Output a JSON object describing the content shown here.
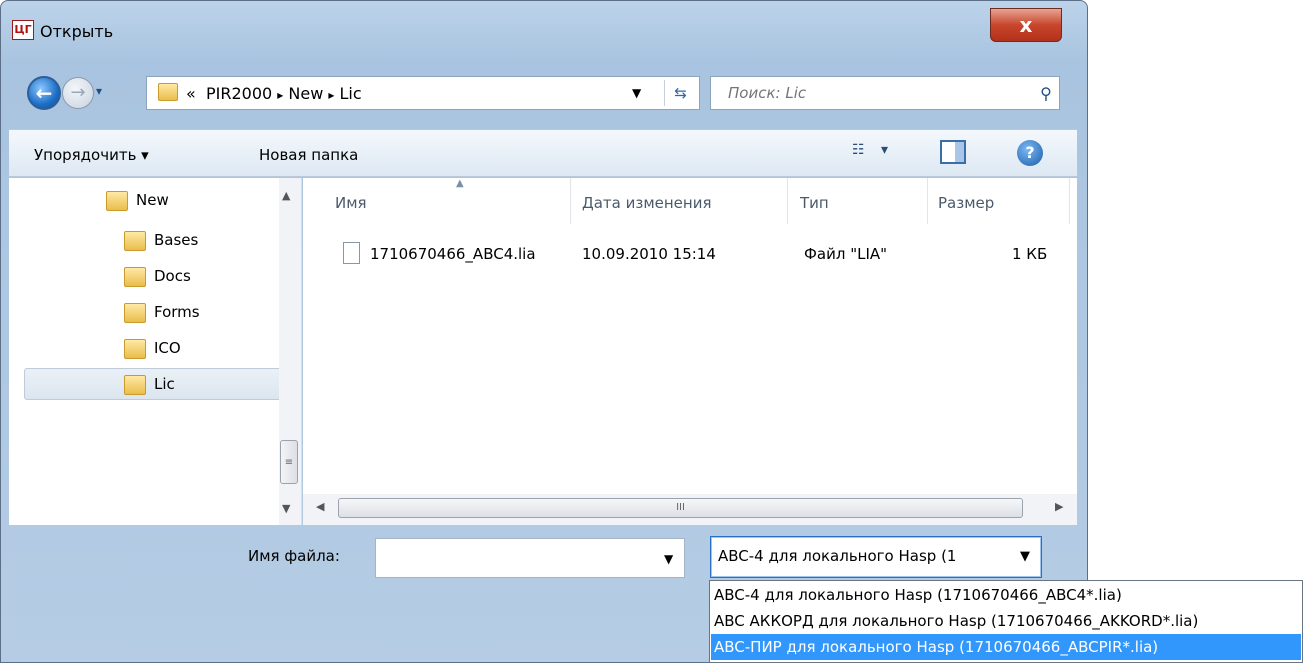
{
  "window": {
    "title": "Открыть",
    "close_label": "x",
    "app_icon_text": "ЦГ"
  },
  "address": {
    "overflow": "«",
    "crumbs": [
      "PIR2000",
      "New",
      "Lic"
    ],
    "separator": "▸"
  },
  "search": {
    "placeholder": "Поиск: Lic"
  },
  "toolbar": {
    "organize_label": "Упорядочить ▾",
    "new_folder_label": "Новая папка",
    "view_label": "▾",
    "help_label": "?"
  },
  "tree": {
    "items": [
      {
        "label": "New"
      },
      {
        "label": "Bases"
      },
      {
        "label": "Docs"
      },
      {
        "label": "Forms"
      },
      {
        "label": "ICO"
      },
      {
        "label": "Lic"
      }
    ],
    "selected": "Lic"
  },
  "file_list": {
    "columns": [
      "Имя",
      "Дата изменения",
      "Тип",
      "Размер"
    ],
    "rows": [
      {
        "name": "1710670466_ABC4.lia",
        "date": "10.09.2010 15:14",
        "type": "Файл \"LIA\"",
        "size": "1 КБ"
      }
    ],
    "hscroll_grip": "III",
    "vscroll_grip": "≡"
  },
  "bottom": {
    "filename_label": "Имя файла:",
    "filename_value": "",
    "filter_selected": "ABC-4 для локального Hasp (1",
    "filter_options": [
      "ABC-4 для локального Hasp (1710670466_ABC4*.lia)",
      "ABC АККОРД для локального Hasp (1710670466_AKKORD*.lia)",
      "ABC-ПИР для локального Hasp (1710670466_ABCPIR*.lia)"
    ],
    "highlighted_index": 2
  },
  "colors": {
    "selection": "#3297fd",
    "frame": "#a9c4e0",
    "close": "#c8462c"
  }
}
